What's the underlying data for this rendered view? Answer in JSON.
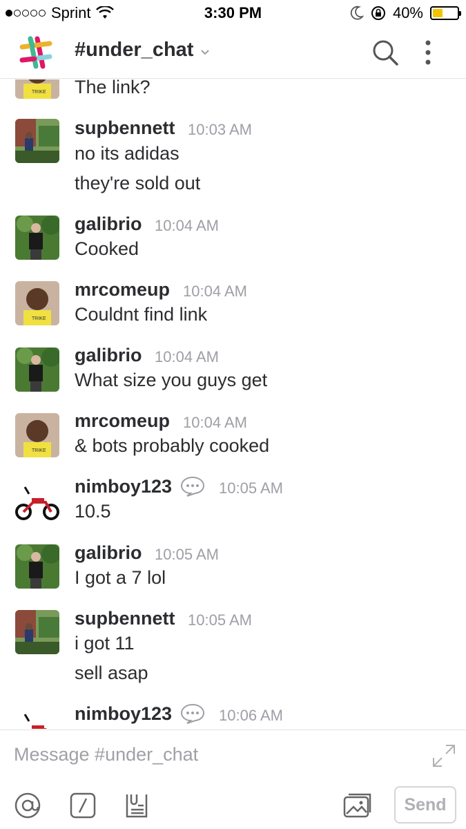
{
  "status_bar": {
    "carrier": "Sprint",
    "time": "3:30 PM",
    "battery": "40%",
    "battery_level": 0.4,
    "battery_color": "#f5c400"
  },
  "header": {
    "channel": "#under_chat",
    "icons": [
      "slack-logo-icon",
      "chevron-down-icon",
      "search-icon",
      "more-vertical-icon"
    ]
  },
  "messages": [
    {
      "author": "",
      "time": "",
      "lines": [
        "The link?"
      ],
      "avatar": "child-avatar"
    },
    {
      "author": "supbennett",
      "time": "10:03 AM",
      "lines": [
        "no its adidas",
        "they're sold out"
      ],
      "avatar": "yard-avatar"
    },
    {
      "author": "galibrio",
      "time": "10:04 AM",
      "lines": [
        "Cooked"
      ],
      "avatar": "outdoor-avatar"
    },
    {
      "author": "mrcomeup",
      "time": "10:04 AM",
      "lines": [
        "Couldnt find link"
      ],
      "avatar": "child-avatar"
    },
    {
      "author": "galibrio",
      "time": "10:04 AM",
      "lines": [
        "What size you guys get"
      ],
      "avatar": "outdoor-avatar"
    },
    {
      "author": "mrcomeup",
      "time": "10:04 AM",
      "lines": [
        "& bots probably cooked"
      ],
      "avatar": "child-avatar"
    },
    {
      "author": "nimboy123",
      "time": "10:05 AM",
      "lines": [
        "10.5"
      ],
      "avatar": "minibike-avatar",
      "has_status": true
    },
    {
      "author": "galibrio",
      "time": "10:05 AM",
      "lines": [
        "I got a 7 lol"
      ],
      "avatar": "outdoor-avatar"
    },
    {
      "author": "supbennett",
      "time": "10:05 AM",
      "lines": [
        "i got 11",
        "sell asap"
      ],
      "avatar": "yard-avatar"
    },
    {
      "author": "nimboy123",
      "time": "10:06 AM",
      "lines": [],
      "avatar": "minibike-avatar",
      "has_status": true
    }
  ],
  "composer": {
    "placeholder": "Message #under_chat",
    "send_label": "Send",
    "icons": [
      "at-mention-icon",
      "slash-command-icon",
      "file-snippet-icon",
      "photo-upload-icon",
      "expand-icon"
    ]
  }
}
